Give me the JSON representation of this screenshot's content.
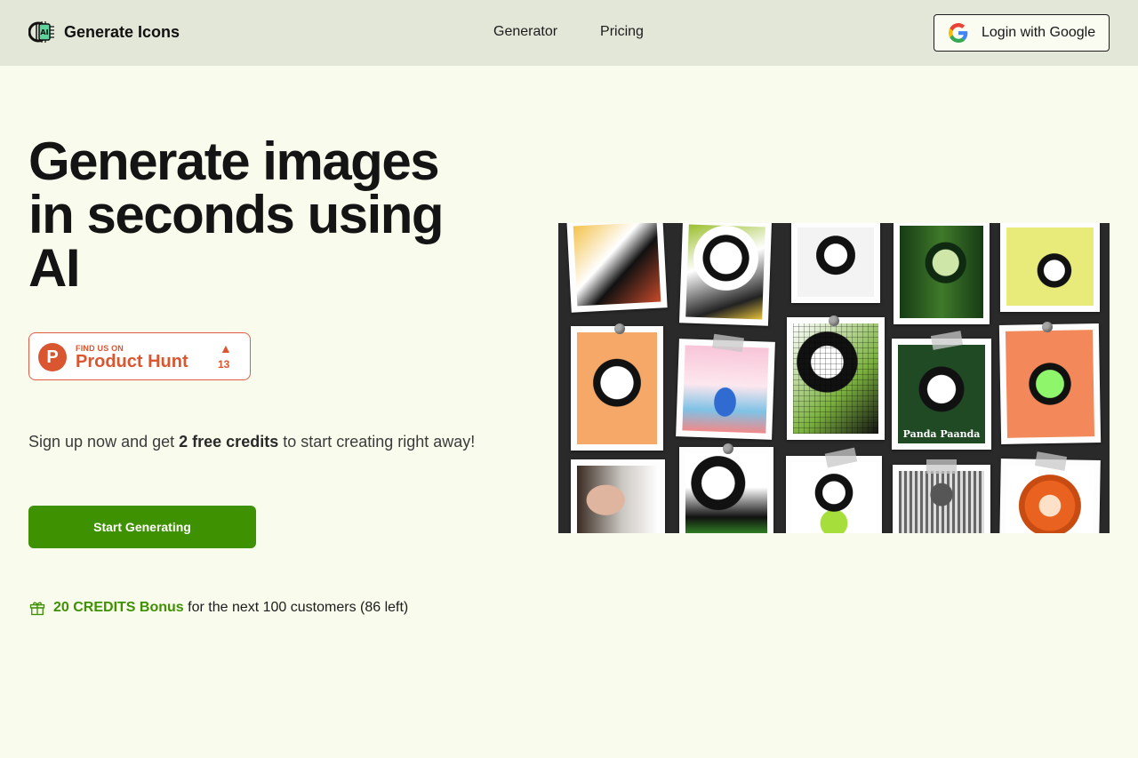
{
  "header": {
    "brand_name": "Generate Icons",
    "logo_icon": "ai-chip-icon",
    "nav": [
      "Generator",
      "Pricing"
    ],
    "login_label": "Login with Google"
  },
  "hero": {
    "title_lines": [
      "Generate images",
      "in seconds using",
      "AI"
    ]
  },
  "product_hunt": {
    "letter": "P",
    "small_label": "FIND US ON",
    "big_label": "Product Hunt",
    "upvote_icon": "triangle-up-icon",
    "count": "13"
  },
  "signup": {
    "before": "Sign up now and get ",
    "strong": "2 free credits",
    "after": " to start creating right away!"
  },
  "cta_label": "Start Generating",
  "bonus": {
    "icon": "gift-icon",
    "strong": "20 CREDITS Bonus",
    "rest": " for the next 100 customers (86 left)"
  },
  "gallery": {
    "caption": "Panda Paanda"
  },
  "colors": {
    "accent_green": "#3e9100",
    "product_hunt": "#da5630",
    "page_bg": "#f9fbec",
    "header_bg": "#e3e7d8"
  }
}
